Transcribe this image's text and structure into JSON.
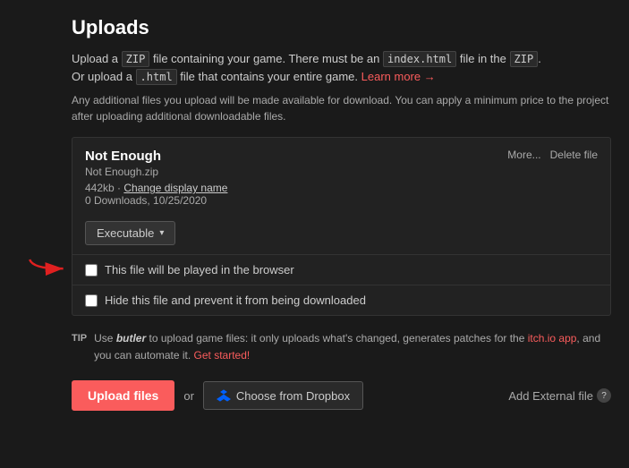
{
  "page": {
    "title": "Uploads"
  },
  "description": {
    "line1_text": "Upload a ",
    "zip_code": "ZIP",
    "line1_mid": " file containing your game. There must be an ",
    "index_code": "index.html",
    "line1_end": " file in the ",
    "zip_code2": "ZIP",
    "line1_end2": ".",
    "line2_text": "Or upload a ",
    "html_code": ".html",
    "line2_end": " file that contains your entire game.",
    "learn_more_text": "Learn more →",
    "learn_more_href": "#"
  },
  "additional_info": "Any additional files you upload will be made available for download. You can apply a minimum price to the project after uploading additional downloadable files.",
  "file": {
    "title": "Not Enough",
    "subtitle": "Not Enough.zip",
    "size": "442kb",
    "change_display_name": "Change display name",
    "downloads": "0 Downloads, 10/25/2020",
    "type_label": "Executable",
    "more_label": "More...",
    "delete_label": "Delete file"
  },
  "checkboxes": {
    "browser_play": "This file will be played in the browser",
    "hide_file": "Hide this file and prevent it from being downloaded"
  },
  "tip": {
    "label": "TIP",
    "text_part1": "Use ",
    "butler_text": "butler",
    "text_part2": " to upload game files: it only uploads what's changed, generates patches for the ",
    "itch_app_text": "itch.io app",
    "text_part3": ", and you can automate it. ",
    "get_started_text": "Get started!"
  },
  "actions": {
    "upload_files": "Upload files",
    "or": "or",
    "dropbox_label": "Choose from Dropbox",
    "add_external": "Add External file",
    "help": "?"
  }
}
